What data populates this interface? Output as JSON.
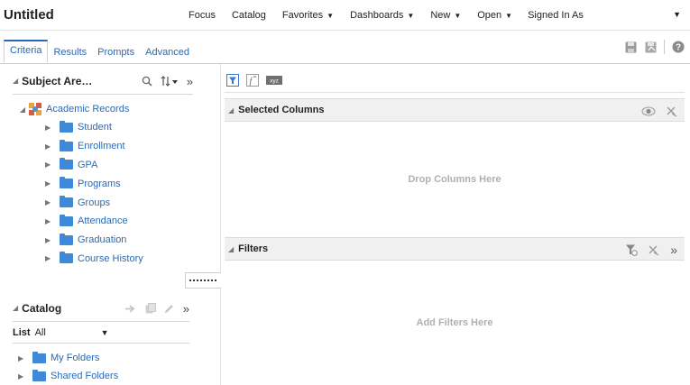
{
  "app": {
    "title": "Untitled"
  },
  "topnav": {
    "items": [
      {
        "label": "Focus",
        "dropdown": false
      },
      {
        "label": "Catalog",
        "dropdown": false
      },
      {
        "label": "Favorites",
        "dropdown": true
      },
      {
        "label": "Dashboards",
        "dropdown": true
      },
      {
        "label": "New",
        "dropdown": true
      },
      {
        "label": "Open",
        "dropdown": true
      }
    ],
    "signed_in_label": "Signed In As"
  },
  "tabs": [
    {
      "label": "Criteria",
      "active": true
    },
    {
      "label": "Results",
      "active": false
    },
    {
      "label": "Prompts",
      "active": false
    },
    {
      "label": "Advanced",
      "active": false
    }
  ],
  "subject_area": {
    "title": "Subject Are…",
    "root": "Academic Records",
    "folders": [
      "Student",
      "Enrollment",
      "GPA",
      "Programs",
      "Groups",
      "Attendance",
      "Graduation",
      "Course History"
    ]
  },
  "catalog": {
    "title": "Catalog",
    "list_label": "List",
    "list_value": "All",
    "folders": [
      "My Folders",
      "Shared Folders"
    ]
  },
  "selected_columns": {
    "title": "Selected Columns",
    "empty_text": "Drop Columns Here"
  },
  "filters": {
    "title": "Filters",
    "empty_text": "Add Filters Here"
  },
  "colors": {
    "link": "#2a6ab5",
    "folder": "#3f8ad8",
    "section_bg": "#f0f0f0",
    "placeholder": "#b0b0b0"
  }
}
